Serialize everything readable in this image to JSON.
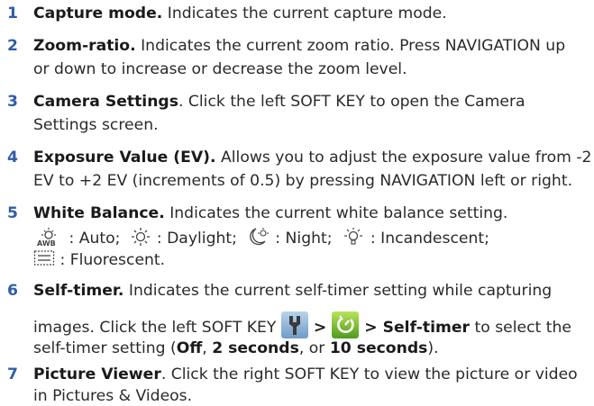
{
  "items": [
    {
      "num": "1",
      "title": "Capture mode.",
      "text": " Indicates the current capture mode."
    },
    {
      "num": "2",
      "title": "Zoom-ratio.",
      "line1": " Indicates the current zoom ratio. Press NAVIGATION up",
      "line2": "or down to increase or decrease the zoom level."
    },
    {
      "num": "3",
      "title": "Camera Settings",
      "line1": ". Click the left SOFT KEY to open the Camera",
      "line2": "Settings screen."
    },
    {
      "num": "4",
      "title": "Exposure Value (EV).",
      "line1": " Allows you to adjust the exposure value from -2",
      "line2": "EV to +2 EV (increments of 0.5) by pressing NAVIGATION left or right."
    },
    {
      "num": "5",
      "title": "White Balance.",
      "line1": " Indicates the current white balance setting.",
      "wb": [
        {
          "icon": "auto-wb-icon",
          "label": " : Auto;"
        },
        {
          "icon": "daylight-wb-icon",
          "label": " : Daylight;"
        },
        {
          "icon": "night-wb-icon",
          "label": " : Night;"
        },
        {
          "icon": "incandescent-wb-icon",
          "label": " : Incandescent;"
        },
        {
          "icon": "fluorescent-wb-icon",
          "label": " : Fluorescent."
        }
      ]
    },
    {
      "num": "6",
      "title": "Self-timer.",
      "line1": " Indicates the current self-timer setting while capturing",
      "line2a": "images. Click the left SOFT KEY ",
      "gt1": " > ",
      "gt2": " > ",
      "line2b": "Self-timer",
      "line2c": " to select the",
      "line3a": "self-timer setting (",
      "off": "Off",
      "comma1": ", ",
      "two": "2 seconds",
      "comma2": ", or ",
      "ten": "10 seconds",
      "line3b": ")."
    },
    {
      "num": "7",
      "title": "Picture Viewer",
      "line1": ". Click the right SOFT KEY to view the picture or video",
      "line2": "in Pictures & Videos."
    }
  ]
}
